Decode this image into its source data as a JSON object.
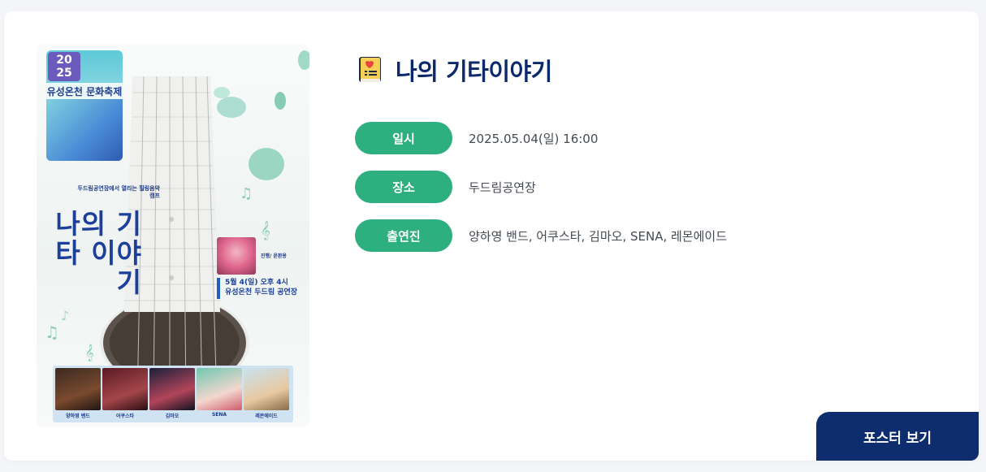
{
  "event": {
    "title": "나의 기타이야기",
    "title_icon": "book-icon"
  },
  "info": [
    {
      "label": "일시",
      "value": "2025.05.04(일) 16:00"
    },
    {
      "label": "장소",
      "value": "두드림공연장"
    },
    {
      "label": "출연진",
      "value": "양하영 밴드, 어쿠스타, 김마오, SENA, 레몬에이드"
    }
  ],
  "poster": {
    "festival_year": "20 25",
    "festival_name": "유성온천 문화축제",
    "intro": "두드림공연장에서 열리는 힐링음악캠프",
    "title": "나의 기타 이야기",
    "host": "진행/ 윤환용",
    "date_line1": "5월 4(일) 오후 4시",
    "date_line2": "유성온천 두드림 공연장",
    "performers": [
      "양하영 밴드",
      "어쿠스타",
      "김마오",
      "SENA",
      "레몬에이드"
    ]
  },
  "buttons": {
    "view_poster": "포스터 보기"
  },
  "colors": {
    "accent_green": "#2eaf80",
    "navy": "#0d2d6e",
    "title_navy": "#0c2a6b"
  }
}
